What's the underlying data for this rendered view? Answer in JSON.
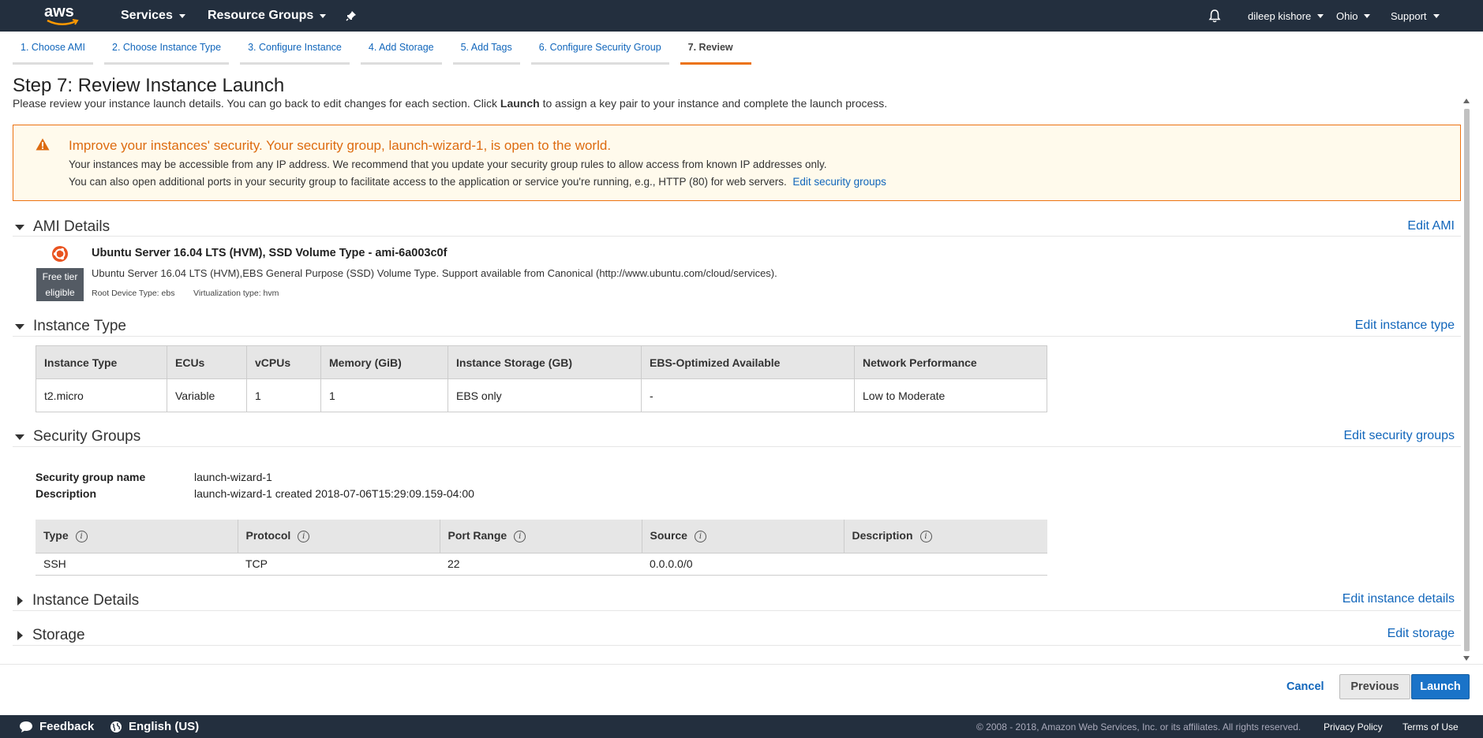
{
  "topnav": {
    "logo_text": "aws",
    "services": "Services",
    "resource_groups": "Resource Groups",
    "user": "dileep kishore",
    "region": "Ohio",
    "support": "Support"
  },
  "tabs": [
    {
      "label": "1. Choose AMI"
    },
    {
      "label": "2. Choose Instance Type"
    },
    {
      "label": "3. Configure Instance"
    },
    {
      "label": "4. Add Storage"
    },
    {
      "label": "5. Add Tags"
    },
    {
      "label": "6. Configure Security Group"
    },
    {
      "label": "7. Review",
      "active": true
    }
  ],
  "page": {
    "title": "Step 7: Review Instance Launch",
    "desc_pre": "Please review your instance launch details. You can go back to edit changes for each section. Click ",
    "desc_bold": "Launch",
    "desc_post": " to assign a key pair to your instance and complete the launch process."
  },
  "warning": {
    "title": "Improve your instances' security. Your security group, launch-wizard-1, is open to the world.",
    "line1": "Your instances may be accessible from any IP address. We recommend that you update your security group rules to allow access from known IP addresses only.",
    "line2": "You can also open additional ports in your security group to facilitate access to the application or service you're running, e.g., HTTP (80) for web servers.",
    "link": "Edit security groups"
  },
  "sections": {
    "ami": {
      "title": "AMI Details",
      "edit": "Edit AMI"
    },
    "instance_type": {
      "title": "Instance Type",
      "edit": "Edit instance type"
    },
    "security_groups": {
      "title": "Security Groups",
      "edit": "Edit security groups"
    },
    "instance_details": {
      "title": "Instance Details",
      "edit": "Edit instance details"
    },
    "storage": {
      "title": "Storage",
      "edit": "Edit storage"
    }
  },
  "ami": {
    "badge_line1": "Free tier",
    "badge_line2": "eligible",
    "name": "Ubuntu Server 16.04 LTS (HVM), SSD Volume Type - ami-6a003c0f",
    "description": "Ubuntu Server 16.04 LTS (HVM),EBS General Purpose (SSD) Volume Type. Support available from Canonical (http://www.ubuntu.com/cloud/services).",
    "root_device": "Root Device Type: ebs",
    "virtualization": "Virtualization type: hvm"
  },
  "instance_table": {
    "headers": [
      "Instance Type",
      "ECUs",
      "vCPUs",
      "Memory (GiB)",
      "Instance Storage (GB)",
      "EBS-Optimized Available",
      "Network Performance"
    ],
    "rows": [
      [
        "t2.micro",
        "Variable",
        "1",
        "1",
        "EBS only",
        "-",
        "Low to Moderate"
      ]
    ]
  },
  "security_group": {
    "name_label": "Security group name",
    "name_value": "launch-wizard-1",
    "desc_label": "Description",
    "desc_value": "launch-wizard-1 created 2018-07-06T15:29:09.159-04:00"
  },
  "rules_table": {
    "headers": [
      "Type",
      "Protocol",
      "Port Range",
      "Source",
      "Description"
    ],
    "rows": [
      [
        "SSH",
        "TCP",
        "22",
        "0.0.0.0/0",
        ""
      ]
    ]
  },
  "actions": {
    "cancel": "Cancel",
    "previous": "Previous",
    "launch": "Launch"
  },
  "footer": {
    "feedback": "Feedback",
    "language": "English (US)",
    "copyright": "© 2008 - 2018, Amazon Web Services, Inc. or its affiliates. All rights reserved.",
    "privacy": "Privacy Policy",
    "terms": "Terms of Use"
  },
  "colors": {
    "nav_bg": "#232f3e",
    "link": "#1166bb",
    "warning": "#dd6b10",
    "launch_button": "#1a73c8",
    "active_tab": "#ec7211"
  }
}
